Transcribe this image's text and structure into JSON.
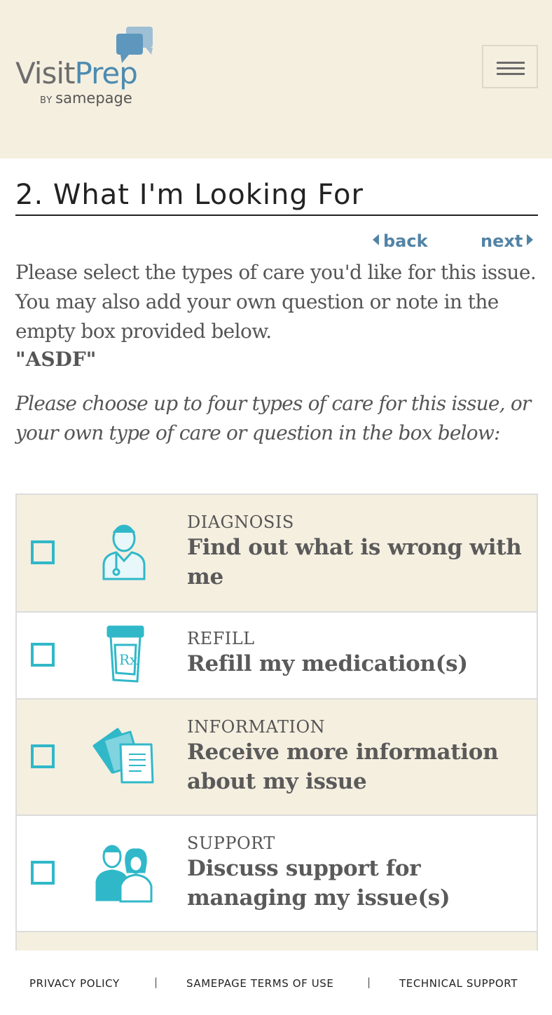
{
  "header": {
    "logo_word_1": "Visit",
    "logo_word_2": "Prep",
    "logo_by": "BY",
    "logo_sub": "samepage",
    "menu_icon": "hamburger-icon"
  },
  "page": {
    "title": "2. What I'm Looking For",
    "back_label": "back",
    "next_label": "next",
    "instructions": "Please select the types of care you'd like for this issue. You may also add your own question or note in the empty box provided below.",
    "issue_name": "\"ASDF\"",
    "sub_instructions": "Please choose up to four types of care for this issue, or your own type of care or question in the box below:"
  },
  "options": [
    {
      "category": "DIAGNOSIS",
      "description": "Find out what is wrong with me",
      "icon": "doctor-icon",
      "checked": false
    },
    {
      "category": "REFILL",
      "description": "Refill my medication(s)",
      "icon": "prescription-bottle-icon",
      "checked": false
    },
    {
      "category": "INFORMATION",
      "description": "Receive more information about my issue",
      "icon": "documents-icon",
      "checked": false
    },
    {
      "category": "SUPPORT",
      "description": "Discuss support for managing my issue(s)",
      "icon": "support-people-icon",
      "checked": false
    }
  ],
  "footer": {
    "privacy": "PRIVACY POLICY",
    "terms": "SAMEPAGE TERMS OF USE",
    "support": "TECHNICAL SUPPORT",
    "separator": "|"
  },
  "colors": {
    "header_bg": "#f5efe0",
    "accent_teal": "#30b8c9",
    "link_blue": "#5283a5",
    "logo_blue": "#4b8bb0"
  }
}
